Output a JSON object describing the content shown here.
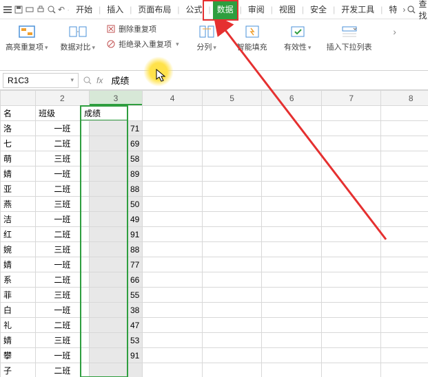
{
  "topbar": {
    "tabs": [
      "开始",
      "插入",
      "页面布局",
      "公式",
      "数据",
      "审阅",
      "视图",
      "安全",
      "开发工具",
      "特"
    ],
    "active_tab_index": 4,
    "search_label": "查找"
  },
  "ribbon": {
    "group1_label": "高亮重复项",
    "group2_label": "数据对比",
    "sub1_label": "删除重复项",
    "sub2_label": "拒绝录入重复项",
    "group3_label": "分列",
    "group4_label": "智能填充",
    "group5_label": "有效性",
    "group6_label": "插入下拉列表"
  },
  "formula_row": {
    "name_box": "R1C3",
    "formula_value": "成绩"
  },
  "sheet": {
    "col_headers": [
      "",
      "2",
      "3",
      "4",
      "5",
      "6",
      "7",
      "8"
    ],
    "selected_col_index": 2,
    "column_c_header": "成绩",
    "column_a_header": "名",
    "column_b_header": "班级",
    "rows": [
      {
        "a": "洛",
        "b": "一班",
        "c": 71
      },
      {
        "a": "七",
        "b": "二班",
        "c": 69
      },
      {
        "a": "萌",
        "b": "三班",
        "c": 58
      },
      {
        "a": "婧",
        "b": "一班",
        "c": 89
      },
      {
        "a": "亚",
        "b": "二班",
        "c": 88
      },
      {
        "a": "燕",
        "b": "三班",
        "c": 50
      },
      {
        "a": "洁",
        "b": "一班",
        "c": 49
      },
      {
        "a": "红",
        "b": "二班",
        "c": 91
      },
      {
        "a": "婉",
        "b": "三班",
        "c": 88
      },
      {
        "a": "婧",
        "b": "一班",
        "c": 77
      },
      {
        "a": "系",
        "b": "二班",
        "c": 66
      },
      {
        "a": "菲",
        "b": "三班",
        "c": 55
      },
      {
        "a": "白",
        "b": "一班",
        "c": 38
      },
      {
        "a": "礼",
        "b": "二班",
        "c": 47
      },
      {
        "a": "婧",
        "b": "三班",
        "c": 53
      },
      {
        "a": "攀",
        "b": "一班",
        "c": 91
      },
      {
        "a": "子",
        "b": "二班",
        "c": ""
      }
    ]
  },
  "chart_data": {
    "type": "table",
    "title": "成绩",
    "columns": [
      "名",
      "班级",
      "成绩"
    ],
    "rows": [
      [
        "洛",
        "一班",
        71
      ],
      [
        "七",
        "二班",
        69
      ],
      [
        "萌",
        "三班",
        58
      ],
      [
        "婧",
        "一班",
        89
      ],
      [
        "亚",
        "二班",
        88
      ],
      [
        "燕",
        "三班",
        50
      ],
      [
        "洁",
        "一班",
        49
      ],
      [
        "红",
        "二班",
        91
      ],
      [
        "婉",
        "三班",
        88
      ],
      [
        "婧",
        "一班",
        77
      ],
      [
        "系",
        "二班",
        66
      ],
      [
        "菲",
        "三班",
        55
      ],
      [
        "白",
        "一班",
        38
      ],
      [
        "礼",
        "二班",
        47
      ],
      [
        "婧",
        "三班",
        53
      ],
      [
        "攀",
        "一班",
        91
      ],
      [
        "子",
        "二班",
        null
      ]
    ]
  }
}
